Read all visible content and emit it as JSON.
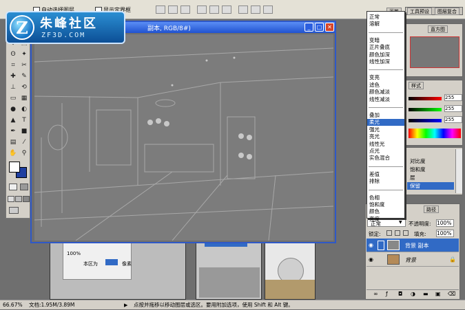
{
  "options_bar": {
    "auto_select_layer": "自动选择图层",
    "show_bounding_box": "显示定界框"
  },
  "logo": {
    "letter": "Z",
    "title": "朱峰社区",
    "subtitle": "ZF3D.COM"
  },
  "document": {
    "title": "副本, RGB/8#)",
    "minimize": "_",
    "maximize": "□",
    "close": "✕"
  },
  "blend_modes": {
    "groups": [
      [
        "正常",
        "溶解"
      ],
      [
        "变暗",
        "正片叠底",
        "颜色加深",
        "线性加深"
      ],
      [
        "变亮",
        "滤色",
        "颜色减淡",
        "线性减淡"
      ],
      [
        "叠加",
        "柔光",
        "强光",
        "亮光",
        "线性光",
        "点光",
        "实色混合"
      ],
      [
        "差值",
        "排除"
      ],
      [
        "色相",
        "饱和度",
        "颜色",
        "亮度"
      ]
    ],
    "selected": "柔光"
  },
  "panels": {
    "top_tabs": [
      "画笔",
      "工具预设",
      "图层复合"
    ],
    "navigator_tab": "直方图",
    "color_tab": "样式",
    "color_values": [
      "255",
      "255",
      "255"
    ],
    "history_items": [
      "对比度",
      "饱和度",
      "层",
      "保留"
    ],
    "paths_tab": "路径"
  },
  "layers_panel": {
    "blend_mode": "正常",
    "opacity_label": "不透明度:",
    "opacity_value": "100%",
    "lock_label": "锁定:",
    "fill_label": "填充:",
    "fill_value": "100%",
    "layers": [
      {
        "name": "背景 副本",
        "selected": true
      },
      {
        "name": "背景",
        "selected": false
      }
    ]
  },
  "back_thumbnail": {
    "value": "100%",
    "label": "本区为",
    "unit": "像素"
  },
  "status_bar": {
    "zoom": "66.67%",
    "doc_size": "文档:1.95M/3.89M",
    "hint": "点按并拖移以移动图层或选区。要用附加选项，使用 Shift 和 Alt 键。"
  },
  "colors": {
    "accent": "#316ac5",
    "title_bar": "#2052d0",
    "panel_bg": "#d4d0c8"
  }
}
